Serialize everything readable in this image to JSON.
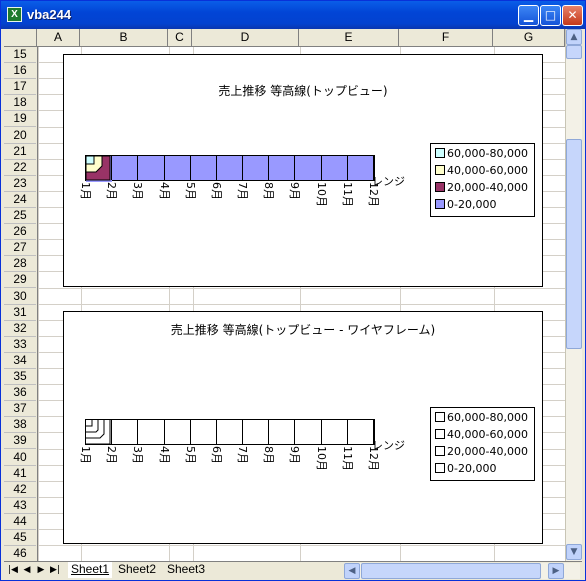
{
  "window": {
    "title": "vba244",
    "app_icon": "excel-icon"
  },
  "columns": [
    "A",
    "B",
    "C",
    "D",
    "E",
    "F",
    "G"
  ],
  "rows": [
    "15",
    "16",
    "17",
    "18",
    "19",
    "20",
    "21",
    "22",
    "23",
    "24",
    "25",
    "26",
    "27",
    "28",
    "29",
    "30",
    "31",
    "32",
    "33",
    "34",
    "35",
    "36",
    "37",
    "38",
    "39",
    "40",
    "41",
    "42",
    "43",
    "44",
    "45",
    "46"
  ],
  "charts": [
    {
      "title": "売上推移 等高線(トップビュー)",
      "categories": [
        "1月",
        "2月",
        "3月",
        "4月",
        "5月",
        "6月",
        "7月",
        "8月",
        "9月",
        "10月",
        "11月",
        "12月"
      ],
      "range_label": "レンジ",
      "legend": [
        {
          "label": "60,000-80,000",
          "color": "#ccffff"
        },
        {
          "label": "40,000-60,000",
          "color": "#ffffcc"
        },
        {
          "label": "20,000-40,000",
          "color": "#993366"
        },
        {
          "label": "0-20,000",
          "color": "#9999ff"
        }
      ]
    },
    {
      "title": "売上推移 等高線(トップビュー - ワイヤフレーム)",
      "categories": [
        "1月",
        "2月",
        "3月",
        "4月",
        "5月",
        "6月",
        "7月",
        "8月",
        "9月",
        "10月",
        "11月",
        "12月"
      ],
      "range_label": "レンジ",
      "legend": [
        {
          "label": "60,000-80,000",
          "color": "#ffffff"
        },
        {
          "label": "40,000-60,000",
          "color": "#ffffff"
        },
        {
          "label": "20,000-40,000",
          "color": "#ffffff"
        },
        {
          "label": "0-20,000",
          "color": "#ffffff"
        }
      ]
    }
  ],
  "sheet_tabs": [
    "Sheet1",
    "Sheet2",
    "Sheet3"
  ],
  "active_tab": "Sheet1"
}
